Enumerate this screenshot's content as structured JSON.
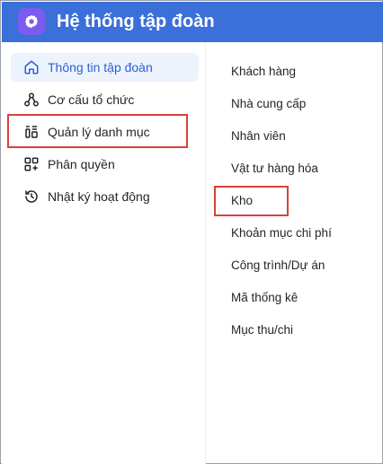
{
  "app": {
    "title": "Hệ thống tập đoàn",
    "icon": "gear-icon"
  },
  "sidebar": {
    "items": [
      {
        "label": "Thông tin tập đoàn",
        "icon": "home-icon",
        "active": true
      },
      {
        "label": "Cơ cấu tổ chức",
        "icon": "org-structure-icon"
      },
      {
        "label": "Quản lý danh mục",
        "icon": "catalog-icon"
      },
      {
        "label": "Phân quyền",
        "icon": "permissions-icon"
      },
      {
        "label": "Nhật ký hoạt động",
        "icon": "history-icon"
      }
    ]
  },
  "submenu": {
    "items": [
      {
        "label": "Khách hàng"
      },
      {
        "label": "Nhà cung cấp"
      },
      {
        "label": "Nhân viên"
      },
      {
        "label": "Vật tư hàng hóa"
      },
      {
        "label": "Kho"
      },
      {
        "label": "Khoản mục chi phí"
      },
      {
        "label": "Công trình/Dự án"
      },
      {
        "label": "Mã thống kê"
      },
      {
        "label": "Mục thu/chi"
      }
    ]
  },
  "colors": {
    "header": "#3b6fd9",
    "logo": "#7b5cf0",
    "active_bg": "#edf3fc",
    "active_text": "#2b5fd6",
    "highlight": "#d9403b"
  }
}
